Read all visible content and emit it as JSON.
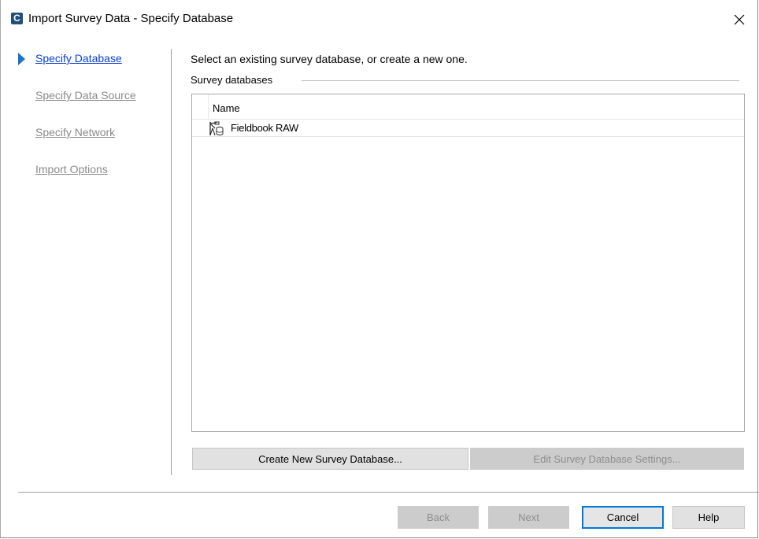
{
  "window": {
    "title": "Import Survey Data - Specify Database",
    "app_icon_letter": "C"
  },
  "nav": {
    "items": [
      {
        "label": "Specify Database",
        "state": "active"
      },
      {
        "label": "Specify Data Source",
        "state": "inactive"
      },
      {
        "label": "Specify Network",
        "state": "inactive"
      },
      {
        "label": "Import Options",
        "state": "inactive"
      }
    ]
  },
  "main": {
    "instructions": "Select an existing survey database, or create a new one.",
    "group_label": "Survey databases",
    "list": {
      "column_header": "Name",
      "rows": [
        {
          "name": "Fieldbook RAW"
        }
      ]
    },
    "create_button": "Create New Survey Database...",
    "edit_button": "Edit Survey Database Settings..."
  },
  "footer": {
    "back": "Back",
    "next": "Next",
    "cancel": "Cancel",
    "help": "Help"
  },
  "colors": {
    "accent": "#0078d7",
    "active_link": "#0b3fd4",
    "inactive_link": "#8a8a8a",
    "nav_arrow": "#1e73c8"
  }
}
